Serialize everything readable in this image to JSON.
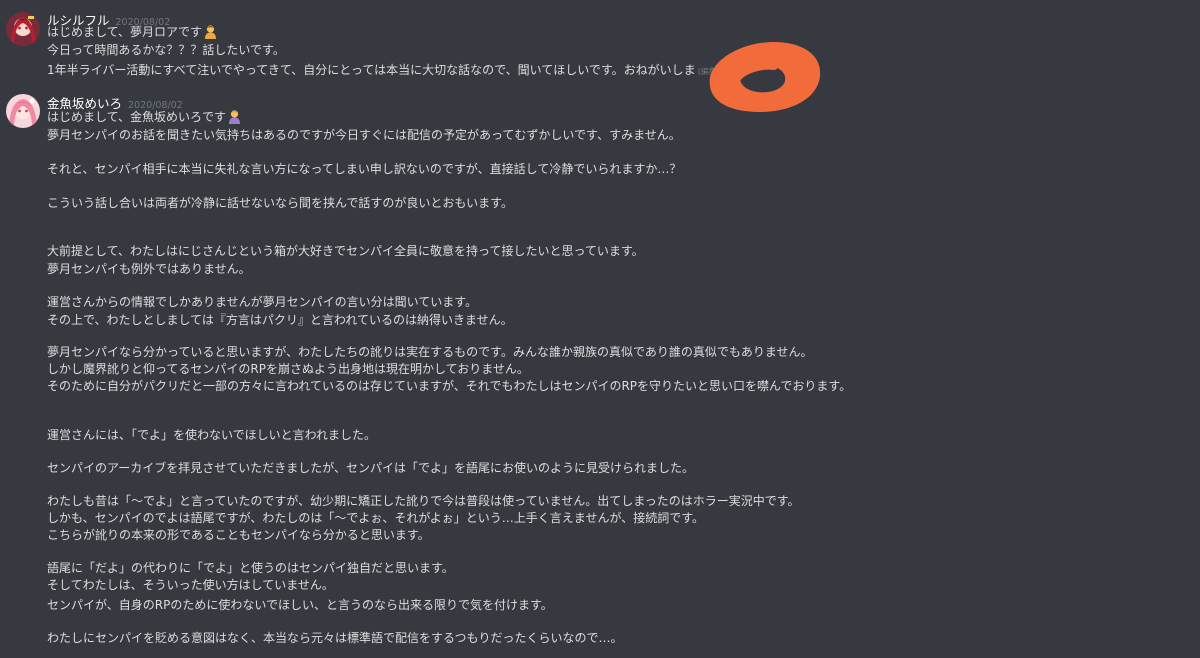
{
  "messages": [
    {
      "username": "ルシルフル",
      "timestamp": "2020/08/02",
      "avatar_icon": "avatar-icon",
      "lines": [
        "はじめまして、夢月ロアです",
        "今日って時間あるかな？？？話したいです。",
        "1年半ライバー活動にすべて注いでやってきて、自分にとっては本当に大切な話なので、聞いてほしいです。おねがいしま"
      ],
      "edited_label": "(編集済)"
    },
    {
      "username": "金魚坂めいろ",
      "timestamp": "2020/08/02",
      "avatar_icon": "avatar-icon",
      "lines": [
        "はじめまして、金魚坂めいろです",
        "夢月センパイのお話を聞きたい気持ちはあるのですが今日すぐには配信の予定があってむずかしいです、すみません。",
        "それと、センパイ相手に本当に失礼な言い方になってしまい申し訳ないのですが、直接話して冷静でいられますか…？",
        "こういう話し合いは両者が冷静に話せないなら間を挟んで話すのが良いとおもいます。",
        "大前提として、わたしはにじさんじという箱が大好きでセンパイ全員に敬意を持って接したいと思っています。",
        "夢月センパイも例外ではありません。",
        "運営さんからの情報でしかありませんが夢月センパイの言い分は聞いています。",
        "その上で、わたしとしましては『方言はパクリ』と言われているのは納得いきません。",
        "夢月センパイなら分かっていると思いますが、わたしたちの訛りは実在するものです。みんな誰か親族の真似であり誰の真似でもありません。",
        "しかし魔界訛りと仰ってるセンパイのRPを崩さぬよう出身地は現在明かしておりません。",
        "そのために自分がパクリだと一部の方々に言われているのは存じていますが、それでもわたしはセンパイのRPを守りたいと思い口を噤んでおります。",
        "運営さんには、「でよ」を使わないでほしいと言われました。",
        "センパイのアーカイブを拝見させていただきましたが、センパイは「でよ」を語尾にお使いのように見受けられました。",
        "わたしも昔は「～でよ」と言っていたのですが、幼少期に矯正した訛りで今は普段は使っていません。出てしまったのはホラー実況中です。",
        "しかも、センパイのでよは語尾ですが、わたしのは「～でよぉ、それがよぉ」という…上手く言えませんが、接続詞です。",
        "こちらが訛りの本来の形であることもセンパイなら分かると思います。",
        "語尾に「だよ」の代わりに「でよ」と使うのはセンパイ独自だと思います。",
        "そしてわたしは、そういった使い方はしていません。",
        "センパイが、自身のRPのために使わないでほしい、と言うのなら出来る限りで気を付けます。",
        "わたしにセンパイを貶める意図はなく、本当なら元々は標準語で配信をするつもりだったくらいなので…。"
      ]
    }
  ],
  "colors": {
    "background": "#36393f",
    "text": "#dcddde",
    "username": "#ffffff",
    "timestamp": "#72767d",
    "scribble": "#f26b3a"
  }
}
